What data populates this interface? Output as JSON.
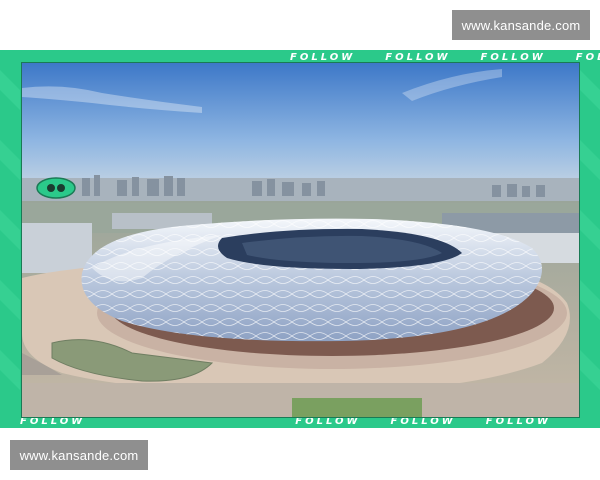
{
  "watermark": {
    "top_text": "www.kansande.com",
    "bottom_text": "www.kansande.com"
  },
  "frame": {
    "ribbon_word": "FOLLOW",
    "accent_color": "#2bc98a",
    "dark_color": "#1a7a55"
  },
  "photo": {
    "subject": "stadium-aerial",
    "sky_color": "#4f86cf",
    "roof_color": "#e8eef6"
  }
}
